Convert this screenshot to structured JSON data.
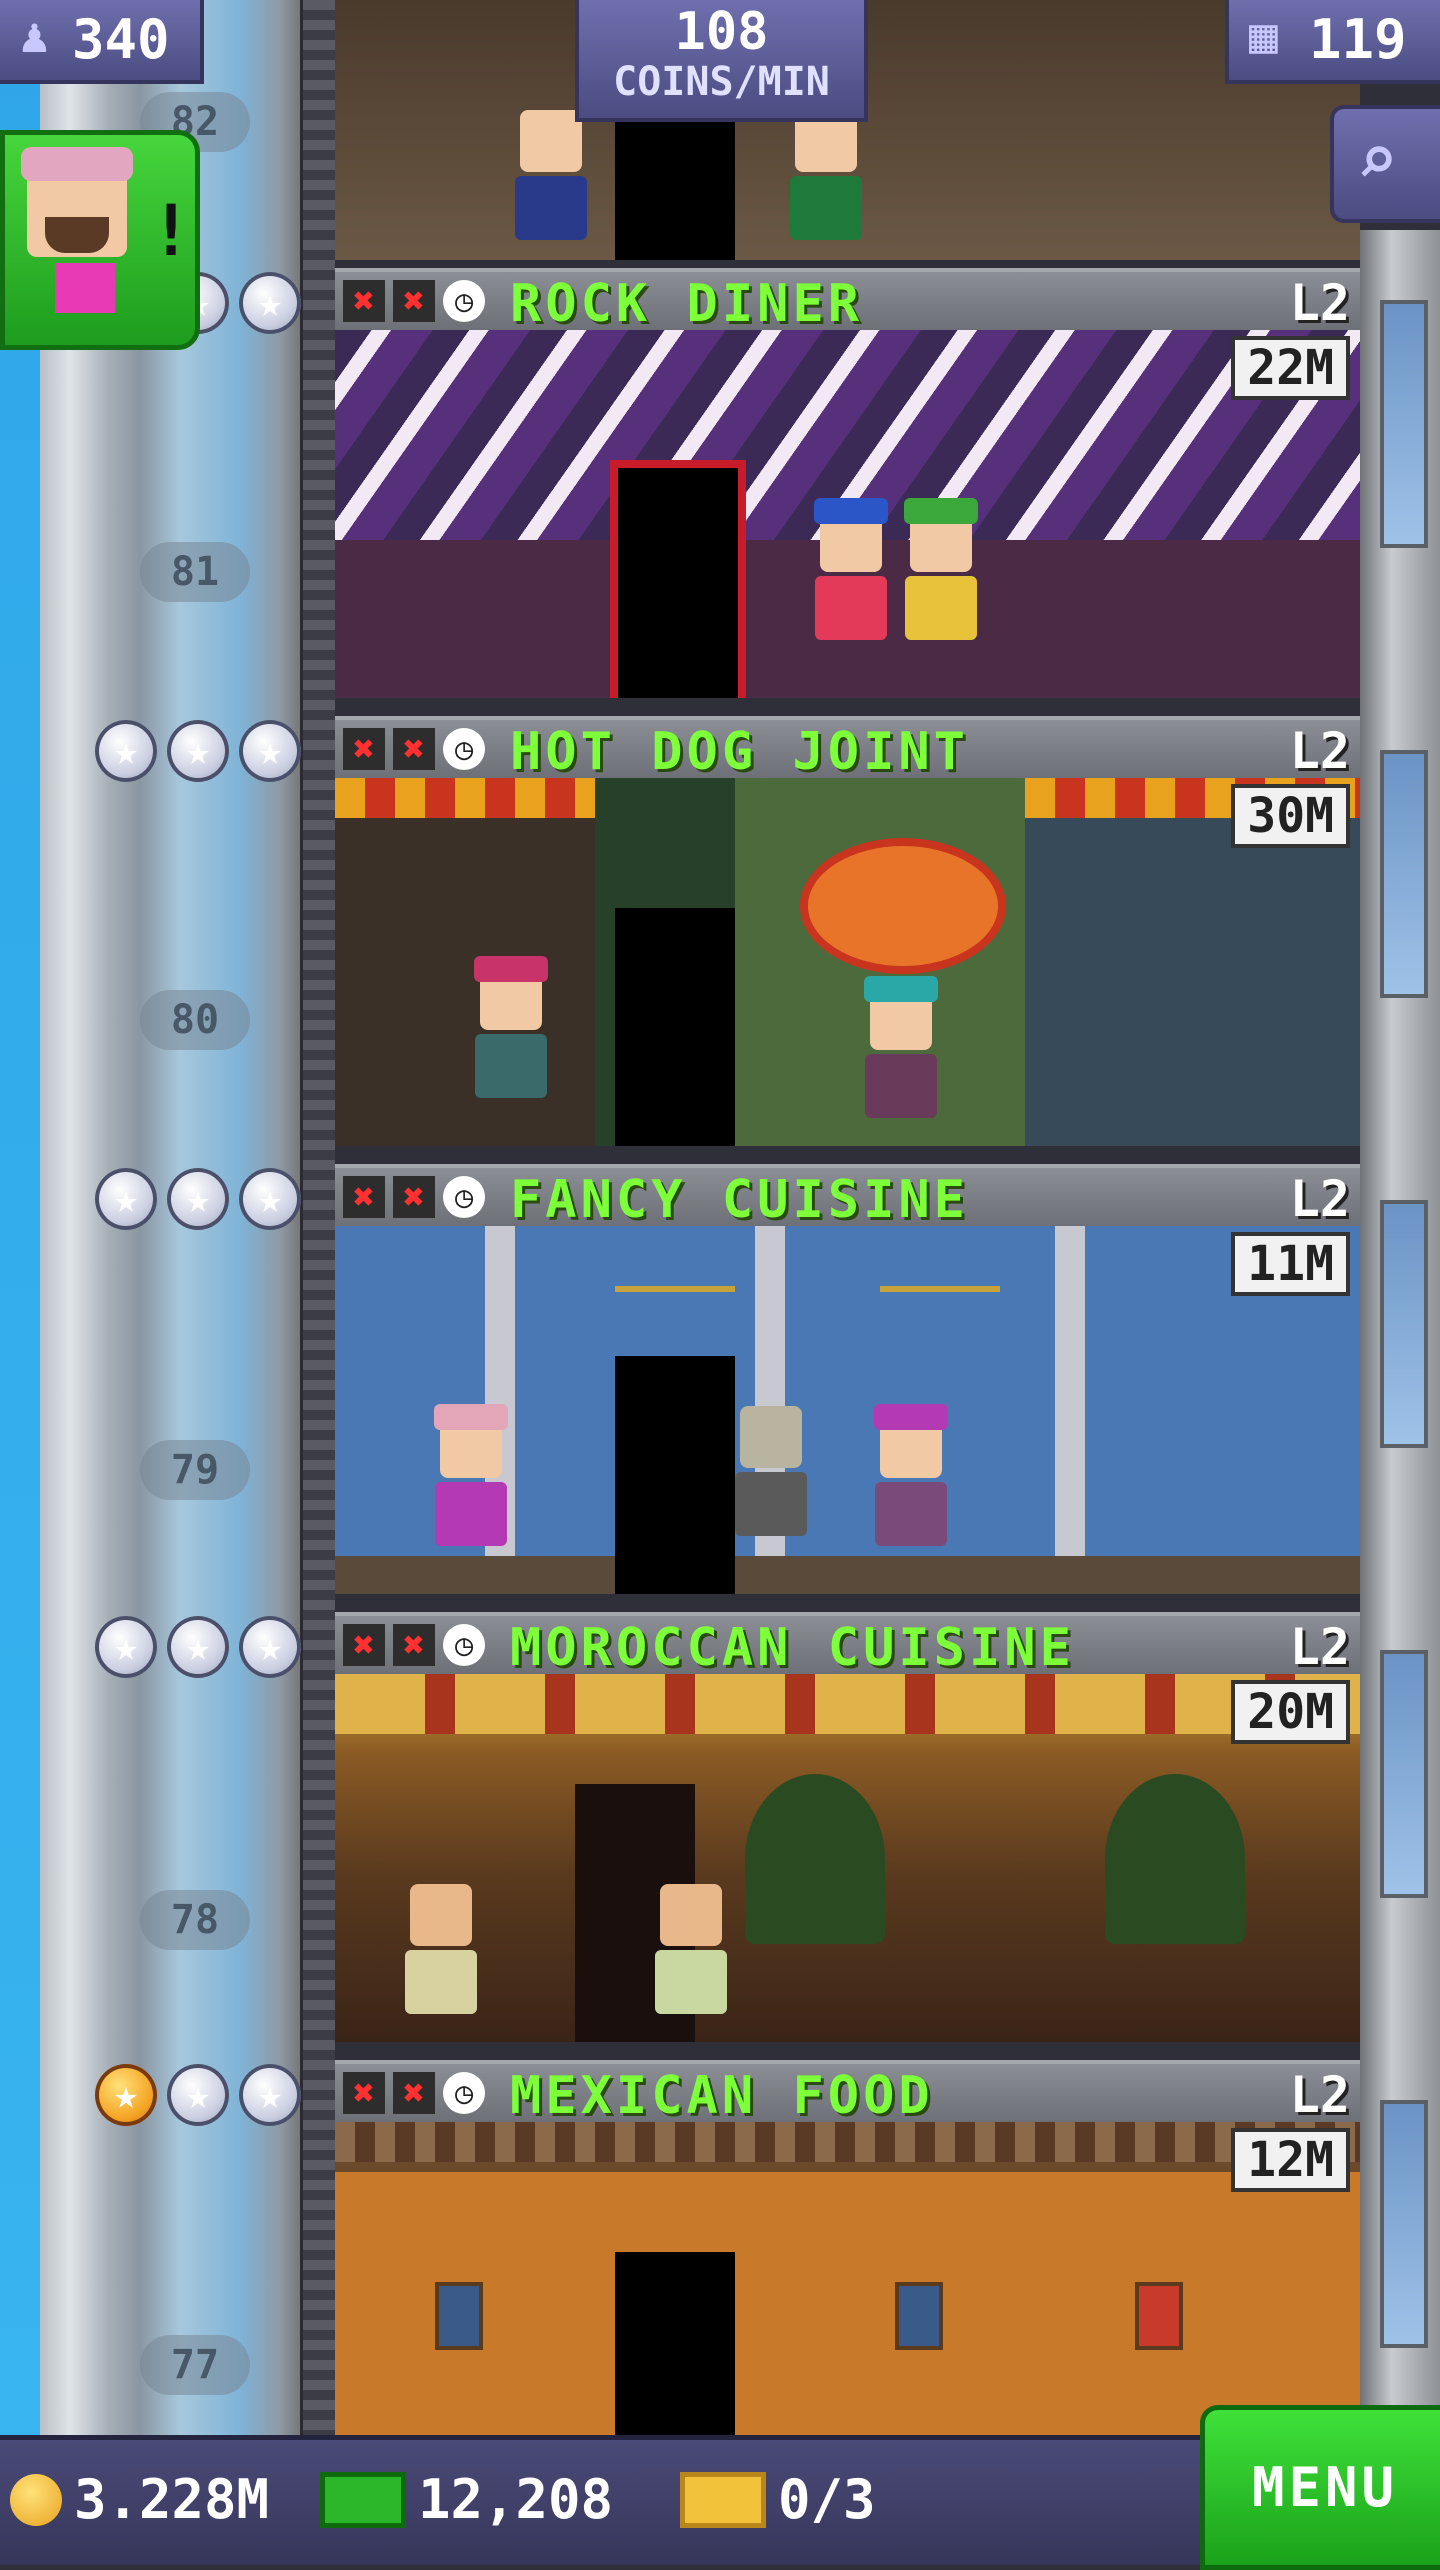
{
  "hud": {
    "population": "340",
    "coins_rate_value": "108",
    "coins_rate_label": "COINS/MIN",
    "floors": "119"
  },
  "floor_numbers": [
    "82",
    "81",
    "80",
    "79",
    "78",
    "77"
  ],
  "floors": [
    {
      "name": "ROCK DINER",
      "level": "L2",
      "stock": "22M",
      "stars_gold": 0
    },
    {
      "name": "HOT DOG JOINT",
      "level": "L2",
      "stock": "30M",
      "stars_gold": 0
    },
    {
      "name": "FANCY CUISINE",
      "level": "L2",
      "stock": "11M",
      "stars_gold": 0
    },
    {
      "name": "MOROCCAN CUISINE",
      "level": "L2",
      "stock": "20M",
      "stars_gold": 0
    },
    {
      "name": "MEXICAN FOOD",
      "level": "L2",
      "stock": "12M",
      "stars_gold": 1
    }
  ],
  "bottom": {
    "coins": "3.228M",
    "bux": "12,208",
    "tickets": "0/3",
    "menu_label": "MENU"
  },
  "notification": {
    "mark": "!"
  },
  "colors": {
    "floor_name": "#7dff3a",
    "menu": "#2fc52a",
    "hud": "#5a5a92"
  }
}
